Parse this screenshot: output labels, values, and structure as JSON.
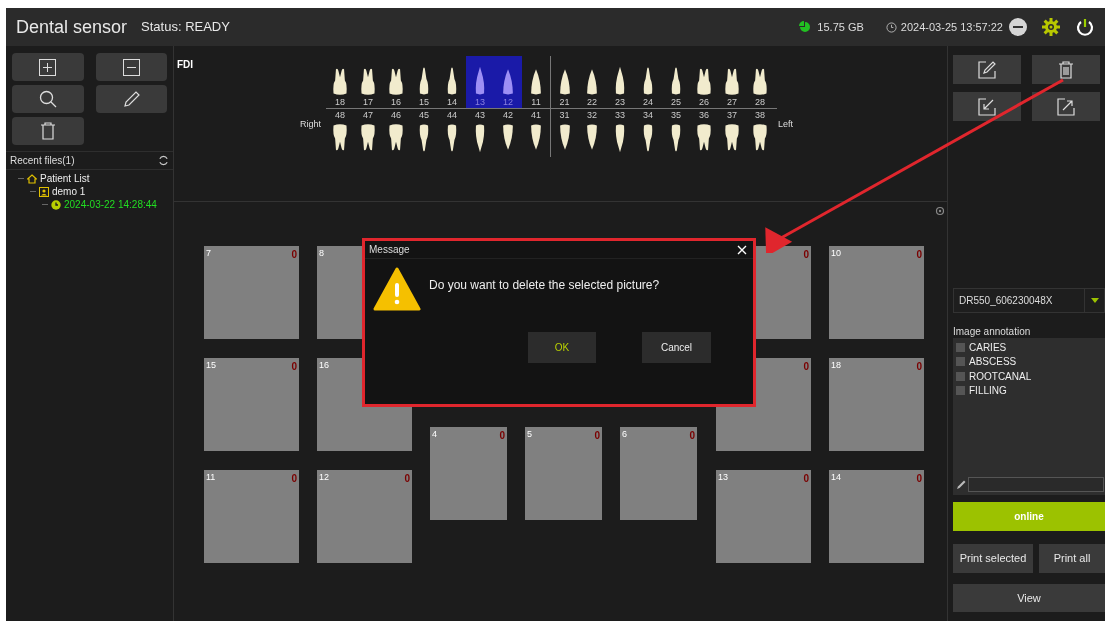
{
  "header": {
    "title": "Dental sensor",
    "status": "Status: READY",
    "storage": "15.75 GB",
    "datetime": "2024-03-25 13:57:22"
  },
  "recent_files": {
    "label": "Recent files(1)",
    "tree": [
      {
        "label": "Patient List",
        "kind": "home",
        "children": [
          {
            "label": "demo 1",
            "kind": "patient",
            "children": [
              {
                "label": "2024-03-22 14:28:44",
                "kind": "record"
              }
            ]
          }
        ]
      }
    ]
  },
  "teeth": {
    "system": "FDI",
    "right_label": "Right",
    "left_label": "Left",
    "upper": [
      {
        "number": "18",
        "kind": "molar",
        "selected": false
      },
      {
        "number": "17",
        "kind": "molar",
        "selected": false
      },
      {
        "number": "16",
        "kind": "molar",
        "selected": false
      },
      {
        "number": "15",
        "kind": "premolar",
        "selected": false
      },
      {
        "number": "14",
        "kind": "premolar",
        "selected": false
      },
      {
        "number": "13",
        "kind": "canine",
        "selected": true
      },
      {
        "number": "12",
        "kind": "incisor",
        "selected": true
      },
      {
        "number": "11",
        "kind": "incisor",
        "selected": false
      },
      {
        "number": "21",
        "kind": "incisor",
        "selected": false
      },
      {
        "number": "22",
        "kind": "incisor",
        "selected": false
      },
      {
        "number": "23",
        "kind": "canine",
        "selected": false
      },
      {
        "number": "24",
        "kind": "premolar",
        "selected": false
      },
      {
        "number": "25",
        "kind": "premolar",
        "selected": false
      },
      {
        "number": "26",
        "kind": "molar",
        "selected": false
      },
      {
        "number": "27",
        "kind": "molar",
        "selected": false
      },
      {
        "number": "28",
        "kind": "molar",
        "selected": false
      }
    ],
    "lower": [
      {
        "number": "48",
        "kind": "molar",
        "selected": false
      },
      {
        "number": "47",
        "kind": "molar",
        "selected": false
      },
      {
        "number": "46",
        "kind": "molar",
        "selected": false
      },
      {
        "number": "45",
        "kind": "premolar",
        "selected": false
      },
      {
        "number": "44",
        "kind": "premolar",
        "selected": false
      },
      {
        "number": "43",
        "kind": "canine",
        "selected": false
      },
      {
        "number": "42",
        "kind": "incisor",
        "selected": false
      },
      {
        "number": "41",
        "kind": "incisor",
        "selected": false
      },
      {
        "number": "31",
        "kind": "incisor",
        "selected": false
      },
      {
        "number": "32",
        "kind": "incisor",
        "selected": false
      },
      {
        "number": "33",
        "kind": "canine",
        "selected": false
      },
      {
        "number": "34",
        "kind": "premolar",
        "selected": false
      },
      {
        "number": "35",
        "kind": "premolar",
        "selected": false
      },
      {
        "number": "36",
        "kind": "molar",
        "selected": false
      },
      {
        "number": "37",
        "kind": "molar",
        "selected": false
      },
      {
        "number": "38",
        "kind": "molar",
        "selected": false
      }
    ]
  },
  "image_slots": {
    "left": [
      {
        "number": "7",
        "count": "0"
      },
      {
        "number": "8"
      },
      {
        "number": "15",
        "count": "0"
      },
      {
        "number": "16"
      },
      {
        "number": "11",
        "count": "0"
      },
      {
        "number": "12",
        "count": "0"
      }
    ],
    "middle": [
      {
        "number": "4",
        "count": "0"
      },
      {
        "number": "5",
        "count": "0"
      },
      {
        "number": "6",
        "count": "0"
      }
    ],
    "right": [
      {
        "count": "0"
      },
      {
        "number": "10",
        "count": "0"
      },
      {
        "count": "0"
      },
      {
        "number": "18",
        "count": "0"
      },
      {
        "number": "13",
        "count": "0"
      },
      {
        "number": "14",
        "count": "0"
      }
    ]
  },
  "device": {
    "value": "DR550_606230048X"
  },
  "annotation": {
    "label": "Image annotation",
    "items": [
      {
        "label": "CARIES",
        "checked": false
      },
      {
        "label": "ABSCESS",
        "checked": false
      },
      {
        "label": "ROOTCANAL",
        "checked": false
      },
      {
        "label": "FILLING",
        "checked": false
      }
    ]
  },
  "buttons": {
    "online": "online",
    "print_selected": "Print selected",
    "print_all": "Print all",
    "view": "View"
  },
  "dialog": {
    "title": "Message",
    "message": "Do you want to delete the selected picture?",
    "ok": "OK",
    "cancel": "Cancel"
  }
}
